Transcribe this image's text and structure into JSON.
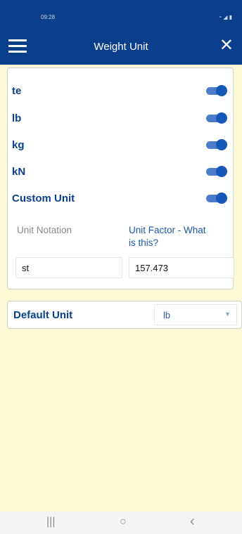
{
  "status_bar": {
    "time": "09:28",
    "system_icons": "◔ ◢ ▮"
  },
  "app_bar": {
    "title": "Weight Unit",
    "menu_icon": "hamburger-icon",
    "close_glyph": "✕"
  },
  "units": [
    {
      "label": "te",
      "enabled": true
    },
    {
      "label": "lb",
      "enabled": true
    },
    {
      "label": "kg",
      "enabled": true
    },
    {
      "label": "kN",
      "enabled": true
    },
    {
      "label": "Custom Unit",
      "enabled": true
    }
  ],
  "custom_unit": {
    "notation_label": "Unit Notation",
    "factor_label_line1": "Unit Factor - What",
    "factor_label_line2": "is this?",
    "notation_value": "st",
    "factor_value": "157.473"
  },
  "default_unit": {
    "label": "Default Unit",
    "selected": "lb"
  },
  "nav_bar": {
    "recents": "|||",
    "home": "○",
    "back": "‹"
  },
  "colors": {
    "primary": "#0a3f8c",
    "toggle_on": "#1558b8",
    "background": "#fdf9d6",
    "link": "#1f56a8"
  }
}
